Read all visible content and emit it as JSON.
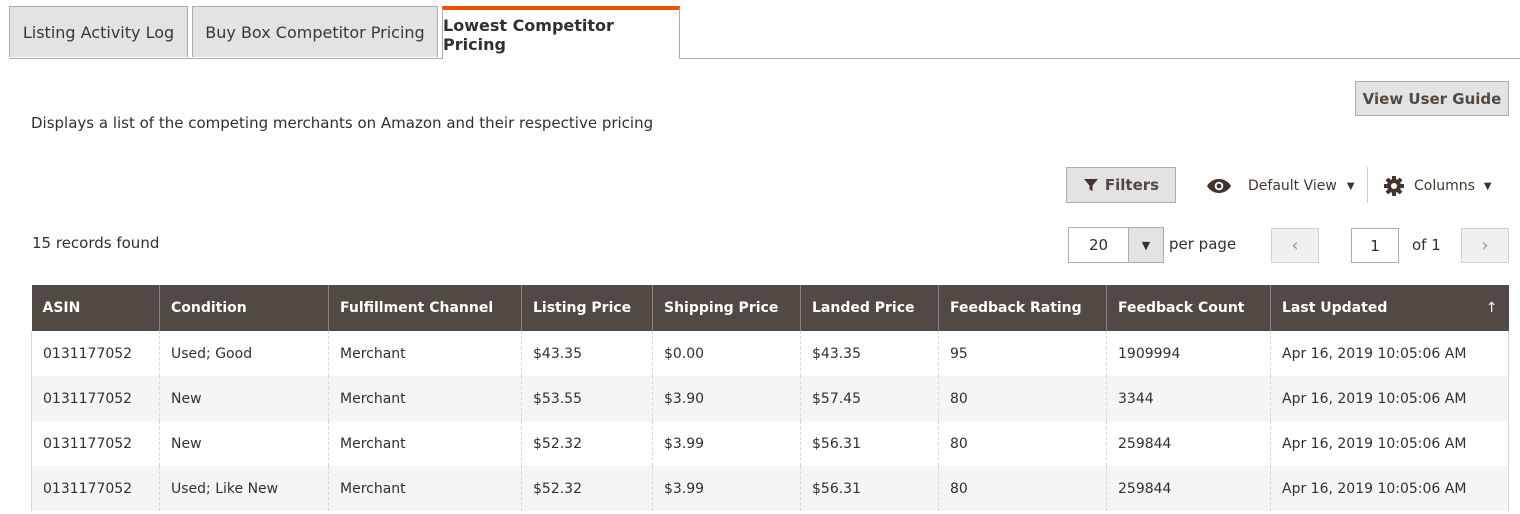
{
  "tabs": [
    {
      "label": "Listing Activity Log"
    },
    {
      "label": "Buy Box Competitor Pricing"
    },
    {
      "label": "Lowest Competitor Pricing"
    }
  ],
  "description": "Displays a list of the competing merchants on Amazon and their respective pricing",
  "user_guide_label": "View User Guide",
  "toolbar": {
    "filters_label": "Filters",
    "view_label": "Default View",
    "columns_label": "Columns"
  },
  "records_found": "15 records found",
  "pagination": {
    "per_page_value": "20",
    "per_page_label": "per page",
    "current_page": "1",
    "of_label": "of 1"
  },
  "table": {
    "columns": [
      "ASIN",
      "Condition",
      "Fulfillment Channel",
      "Listing Price",
      "Shipping Price",
      "Landed Price",
      "Feedback Rating",
      "Feedback Count",
      "Last Updated"
    ],
    "sort_indicator": "↑",
    "rows": [
      [
        "0131177052",
        "Used; Good",
        "Merchant",
        "$43.35",
        "$0.00",
        "$43.35",
        "95",
        "1909994",
        "Apr 16, 2019 10:05:06 AM"
      ],
      [
        "0131177052",
        "New",
        "Merchant",
        "$53.55",
        "$3.90",
        "$57.45",
        "80",
        "3344",
        "Apr 16, 2019 10:05:06 AM"
      ],
      [
        "0131177052",
        "New",
        "Merchant",
        "$52.32",
        "$3.99",
        "$56.31",
        "80",
        "259844",
        "Apr 16, 2019 10:05:06 AM"
      ],
      [
        "0131177052",
        "Used; Like New",
        "Merchant",
        "$52.32",
        "$3.99",
        "$56.31",
        "80",
        "259844",
        "Apr 16, 2019 10:05:06 AM"
      ]
    ]
  },
  "colors": {
    "accent": "#eb5202",
    "header_bg": "#514943"
  }
}
